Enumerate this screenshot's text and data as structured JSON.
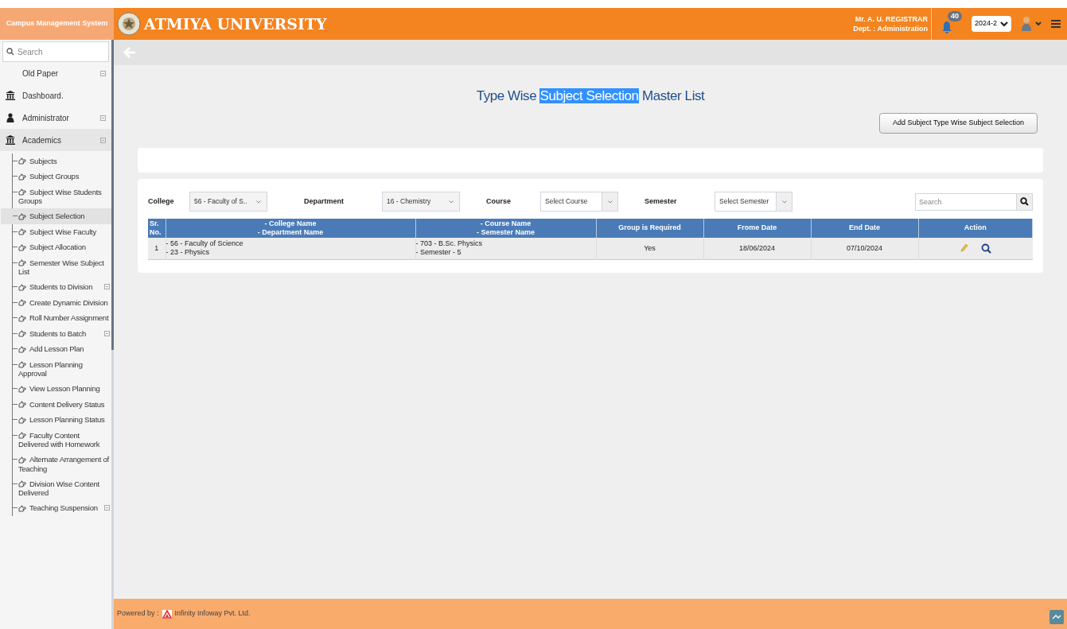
{
  "header": {
    "system_name": "Campus Management System",
    "university": "ATMIYA UNIVERSITY",
    "user_name": "Mr. A. U. REGISTRAR",
    "user_dept": "Dept. : Administration",
    "notification_count": "40",
    "term": "2024-2"
  },
  "sidebar": {
    "search": {
      "placeholder": "Search"
    },
    "items": [
      {
        "label": "Old Paper",
        "expandable": true,
        "expanded": false,
        "selected": false
      },
      {
        "label": "Dashboard.",
        "expandable": false,
        "expanded": false,
        "selected": false
      },
      {
        "label": "Administrator",
        "expandable": true,
        "expanded": false,
        "selected": false
      },
      {
        "label": "Academics",
        "expandable": true,
        "expanded": true,
        "selected": false,
        "children": [
          {
            "label": "Subjects",
            "expandable": false,
            "selected": false
          },
          {
            "label": "Subject Groups",
            "expandable": false,
            "selected": false
          },
          {
            "label": "Subject Wise Students Groups",
            "expandable": false,
            "selected": false
          },
          {
            "label": "Subject Selection",
            "expandable": false,
            "selected": true
          },
          {
            "label": "Subject Wise Faculty",
            "expandable": false,
            "selected": false
          },
          {
            "label": "Subject Allocation",
            "expandable": false,
            "selected": false
          },
          {
            "label": "Semester Wise Subject List",
            "expandable": false,
            "selected": false
          },
          {
            "label": "Students to Division",
            "expandable": true,
            "selected": false
          },
          {
            "label": "Create Dynamic Division",
            "expandable": false,
            "selected": false
          },
          {
            "label": "Roll Number Assignment",
            "expandable": false,
            "selected": false
          },
          {
            "label": "Students to Batch",
            "expandable": true,
            "selected": false
          },
          {
            "label": "Add Lesson Plan",
            "expandable": false,
            "selected": false
          },
          {
            "label": "Lesson Planning Approval",
            "expandable": false,
            "selected": false
          },
          {
            "label": "View Lesson Planning",
            "expandable": false,
            "selected": false
          },
          {
            "label": "Content Delivery Status",
            "expandable": false,
            "selected": false
          },
          {
            "label": "Lesson Planning Status",
            "expandable": false,
            "selected": false
          },
          {
            "label": "Faculty Content Delivered with Homework",
            "expandable": false,
            "selected": false
          },
          {
            "label": "Alternate Arrangement of Teaching",
            "expandable": false,
            "selected": false
          },
          {
            "label": "Division Wise Content Delivered",
            "expandable": false,
            "selected": false
          },
          {
            "label": "Teaching Suspension",
            "expandable": true,
            "selected": false
          }
        ]
      }
    ]
  },
  "page": {
    "title_parts": [
      {
        "text": "Type Wise ",
        "highlighted": false
      },
      {
        "text": "Subject Selection",
        "highlighted": true
      },
      {
        "text": " Master List",
        "highlighted": false
      }
    ],
    "add_button": "Add Subject Type Wise Subject Selection",
    "filters": [
      {
        "label": "College",
        "value": "56 - Faculty of S..",
        "placeholder_style": false
      },
      {
        "label": "Department",
        "value": "16 - Chemistry",
        "placeholder_style": false
      },
      {
        "label": "Course",
        "value": "Select Course",
        "placeholder_style": true
      },
      {
        "label": "Semester",
        "value": "Select Semester",
        "placeholder_style": true
      }
    ],
    "search": {
      "placeholder": "Search"
    },
    "table": {
      "columns": [
        [
          "Sr.",
          "No."
        ],
        [
          "- College Name",
          "- Department Name"
        ],
        [
          "- Course Name",
          "- Semester Name"
        ],
        [
          "Group is Required"
        ],
        [
          "Frome Date"
        ],
        [
          "End Date"
        ],
        [
          "Action"
        ]
      ],
      "rows": [
        {
          "sr": "1",
          "college": [
            "- 56 - Faculty of Science",
            "- 23 - Physics"
          ],
          "course": [
            "- 703 - B.Sc. Physics",
            "- Semester - 5"
          ],
          "group_required": "Yes",
          "from_date": "18/06/2024",
          "end_date": "07/10/2024"
        }
      ]
    }
  },
  "footer": {
    "powered_by": "Powered by :",
    "company": "Infinity Infoway Pvt. Ltd."
  }
}
